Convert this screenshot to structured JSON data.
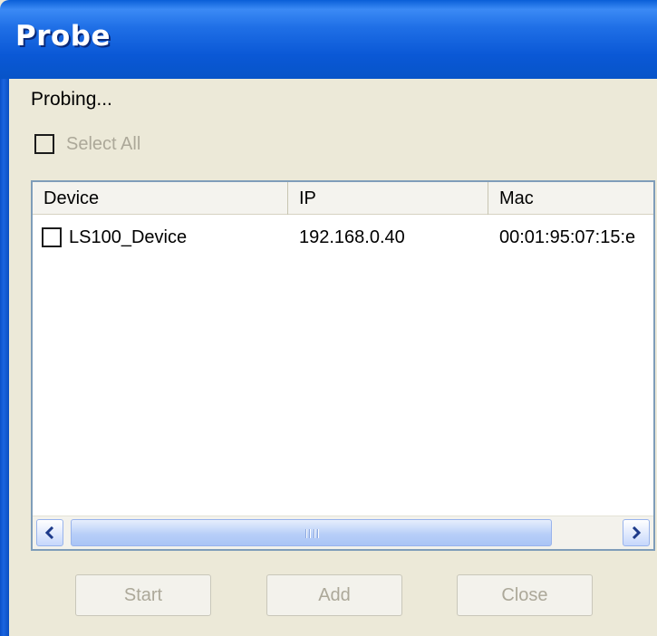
{
  "window": {
    "title": "Probe"
  },
  "status_text": "Probing...",
  "select_all": {
    "label": "Select All",
    "checked": false,
    "enabled": false
  },
  "device_list": {
    "columns": [
      "Device",
      "IP",
      "Mac"
    ],
    "rows": [
      {
        "device": "LS100_Device",
        "ip": "192.168.0.40",
        "mac": "00:01:95:07:15:e",
        "checked": false
      }
    ]
  },
  "buttons": {
    "start": "Start",
    "add": "Add",
    "close": "Close"
  },
  "colors": {
    "titlebar": "#0a58d6",
    "window_bg": "#ece9d8",
    "disabled_text": "#aca899",
    "list_border": "#7f9db9"
  }
}
